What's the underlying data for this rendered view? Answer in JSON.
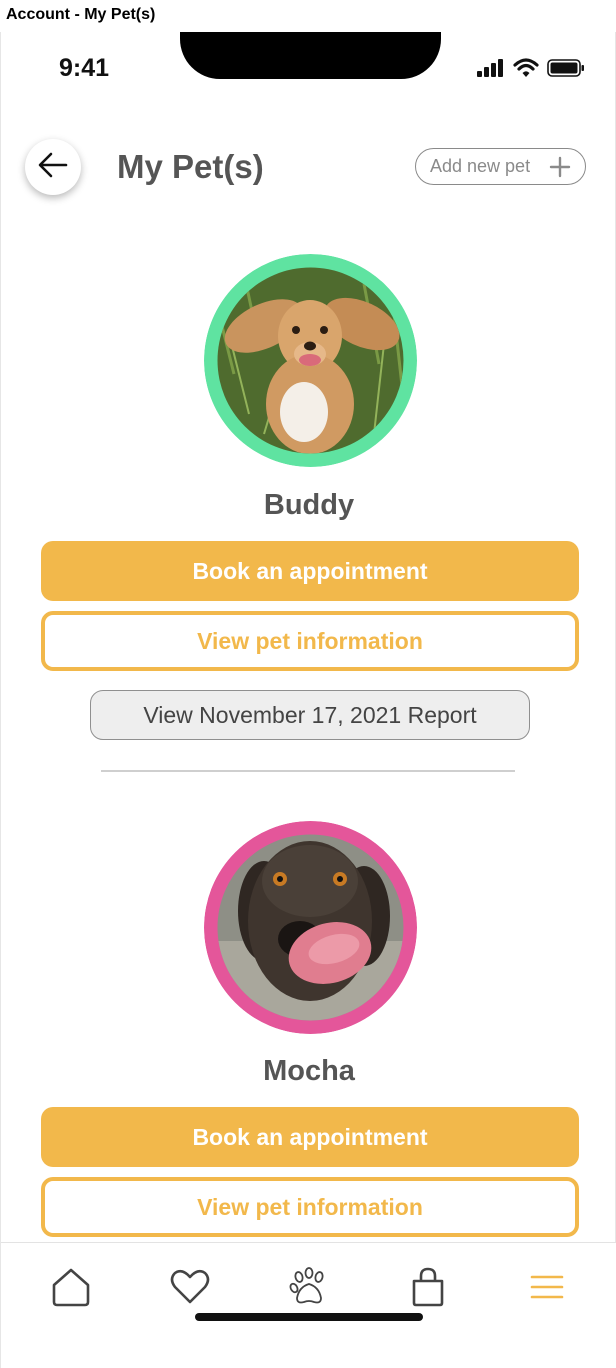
{
  "window": {
    "title": "Account - My Pet(s)"
  },
  "status_bar": {
    "time": "9:41"
  },
  "header": {
    "title": "My Pet(s)",
    "add_pet_label": "Add new pet"
  },
  "pets": [
    {
      "name": "Buddy",
      "ring_color": "#5fe3a1",
      "book_label": "Book an appointment",
      "view_label": "View pet information",
      "report_label": "View November 17, 2021 Report"
    },
    {
      "name": "Mocha",
      "ring_color": "#e4569a",
      "book_label": "Book an appointment",
      "view_label": "View pet information"
    }
  ],
  "tab_bar": {
    "items": [
      {
        "icon": "home-icon"
      },
      {
        "icon": "heart-icon"
      },
      {
        "icon": "paw-icon"
      },
      {
        "icon": "shopping-bag-icon"
      },
      {
        "icon": "menu-icon",
        "active": true
      }
    ]
  },
  "colors": {
    "accent": "#f2b84b",
    "title_text": "#555555",
    "icon_gray": "#444444"
  }
}
